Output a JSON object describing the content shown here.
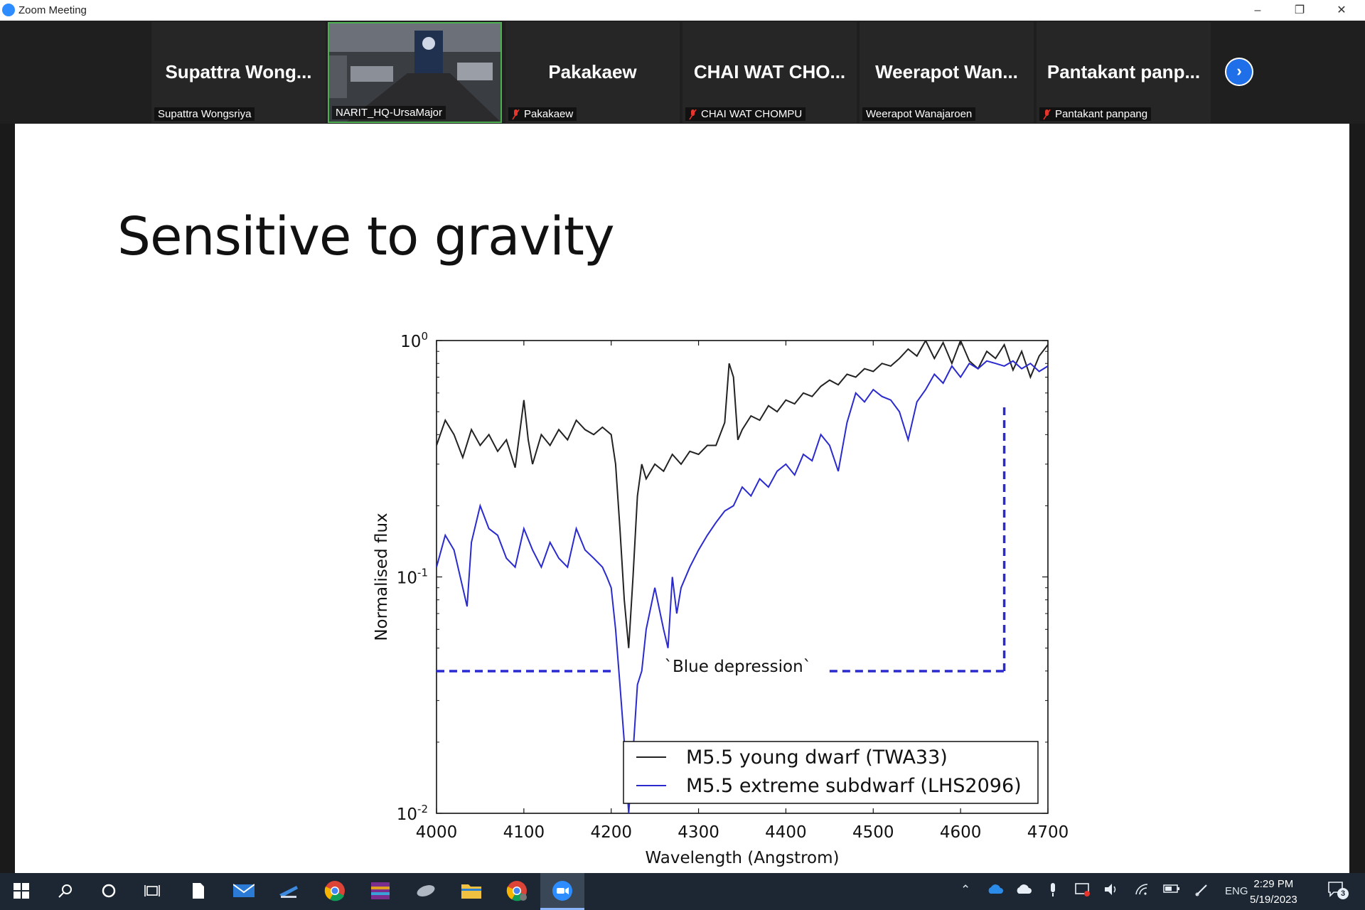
{
  "window": {
    "title": "Zoom Meeting"
  },
  "gallery": {
    "tiles": [
      {
        "big": "Supattra  Wong...",
        "label": "Supattra Wongsriya",
        "muted": false
      },
      {
        "big": "",
        "label": "NARIT_HQ-UrsaMajor",
        "muted": false,
        "video": true
      },
      {
        "big": "Pakakaew",
        "label": "Pakakaew",
        "muted": true
      },
      {
        "big": "CHAI WAT CHO...",
        "label": "CHAI WAT CHOMPU",
        "muted": true
      },
      {
        "big": "Weerapot  Wan...",
        "label": "Weerapot Wanajaroen",
        "muted": false
      },
      {
        "big": "Pantakant  panp...",
        "label": "Pantakant panpang",
        "muted": true
      }
    ]
  },
  "slide": {
    "title": "Sensitive to gravity"
  },
  "chart_data": {
    "type": "line",
    "xlabel": "Wavelength (Angstrom)",
    "ylabel": "Normalised flux",
    "xlim": [
      4000,
      4700
    ],
    "ylim": [
      0.01,
      1
    ],
    "yscale": "log",
    "xticks": [
      "4000",
      "4100",
      "4200",
      "4300",
      "4400",
      "4500",
      "4600",
      "4700"
    ],
    "yticks": [
      {
        "base": "10",
        "exp": "0"
      },
      {
        "base": "10",
        "exp": "-1"
      },
      {
        "base": "10",
        "exp": "-2"
      }
    ],
    "annotation": "`Blue depression`",
    "legend_position": "bottom-right",
    "series": [
      {
        "name": "M5.5 young dwarf (TWA33)",
        "color": "#222222",
        "x": [
          4000,
          4010,
          4020,
          4030,
          4040,
          4050,
          4060,
          4070,
          4080,
          4090,
          4095,
          4100,
          4105,
          4110,
          4120,
          4130,
          4140,
          4150,
          4160,
          4170,
          4180,
          4190,
          4200,
          4205,
          4210,
          4215,
          4220,
          4225,
          4230,
          4235,
          4240,
          4250,
          4260,
          4270,
          4280,
          4290,
          4300,
          4310,
          4320,
          4330,
          4335,
          4340,
          4345,
          4350,
          4360,
          4370,
          4380,
          4390,
          4400,
          4410,
          4420,
          4430,
          4440,
          4450,
          4460,
          4470,
          4480,
          4490,
          4500,
          4510,
          4520,
          4530,
          4540,
          4550,
          4560,
          4570,
          4580,
          4590,
          4600,
          4610,
          4620,
          4630,
          4640,
          4650,
          4660,
          4670,
          4680,
          4690,
          4700
        ],
        "y": [
          0.36,
          0.46,
          0.4,
          0.32,
          0.42,
          0.36,
          0.4,
          0.34,
          0.38,
          0.29,
          0.4,
          0.56,
          0.38,
          0.3,
          0.4,
          0.36,
          0.42,
          0.38,
          0.46,
          0.42,
          0.4,
          0.43,
          0.4,
          0.3,
          0.16,
          0.08,
          0.05,
          0.1,
          0.22,
          0.3,
          0.26,
          0.3,
          0.28,
          0.33,
          0.3,
          0.34,
          0.33,
          0.36,
          0.36,
          0.45,
          0.8,
          0.7,
          0.38,
          0.42,
          0.48,
          0.46,
          0.53,
          0.5,
          0.56,
          0.54,
          0.6,
          0.58,
          0.64,
          0.68,
          0.65,
          0.72,
          0.7,
          0.76,
          0.74,
          0.8,
          0.78,
          0.84,
          0.92,
          0.86,
          1.0,
          0.84,
          0.98,
          0.8,
          1.0,
          0.82,
          0.76,
          0.9,
          0.84,
          0.96,
          0.75,
          0.9,
          0.7,
          0.86,
          0.96
        ]
      },
      {
        "name": "M5.5 extreme subdwarf (LHS2096)",
        "color": "#2a2acf",
        "x": [
          4000,
          4010,
          4020,
          4030,
          4035,
          4040,
          4050,
          4060,
          4070,
          4080,
          4090,
          4100,
          4110,
          4120,
          4130,
          4140,
          4150,
          4160,
          4170,
          4180,
          4190,
          4195,
          4200,
          4205,
          4210,
          4215,
          4220,
          4225,
          4230,
          4235,
          4240,
          4250,
          4260,
          4265,
          4270,
          4275,
          4280,
          4290,
          4300,
          4310,
          4320,
          4330,
          4340,
          4350,
          4360,
          4370,
          4380,
          4390,
          4400,
          4410,
          4420,
          4430,
          4440,
          4450,
          4460,
          4470,
          4480,
          4490,
          4500,
          4510,
          4520,
          4530,
          4540,
          4550,
          4560,
          4570,
          4580,
          4590,
          4600,
          4610,
          4620,
          4630,
          4640,
          4650,
          4660,
          4670,
          4680,
          4690,
          4700
        ],
        "y": [
          0.11,
          0.15,
          0.13,
          0.09,
          0.075,
          0.14,
          0.2,
          0.16,
          0.15,
          0.12,
          0.11,
          0.16,
          0.13,
          0.11,
          0.14,
          0.12,
          0.11,
          0.16,
          0.13,
          0.12,
          0.11,
          0.1,
          0.09,
          0.06,
          0.035,
          0.02,
          0.01,
          0.018,
          0.035,
          0.04,
          0.06,
          0.09,
          0.06,
          0.05,
          0.1,
          0.07,
          0.09,
          0.11,
          0.13,
          0.15,
          0.17,
          0.19,
          0.2,
          0.24,
          0.22,
          0.26,
          0.24,
          0.28,
          0.3,
          0.27,
          0.33,
          0.31,
          0.4,
          0.36,
          0.28,
          0.45,
          0.6,
          0.55,
          0.62,
          0.58,
          0.56,
          0.5,
          0.38,
          0.55,
          0.62,
          0.72,
          0.66,
          0.78,
          0.7,
          0.8,
          0.76,
          0.82,
          0.8,
          0.78,
          0.82,
          0.76,
          0.8,
          0.74,
          0.78
        ]
      }
    ]
  },
  "taskbar": {
    "tray_lang": "ENG",
    "time": "2:29 PM",
    "date": "5/19/2023",
    "notifications": "3"
  },
  "colors": {
    "accent": "#2d8cff",
    "active_speaker": "#4caf50",
    "taskbar": "#1c2733"
  }
}
